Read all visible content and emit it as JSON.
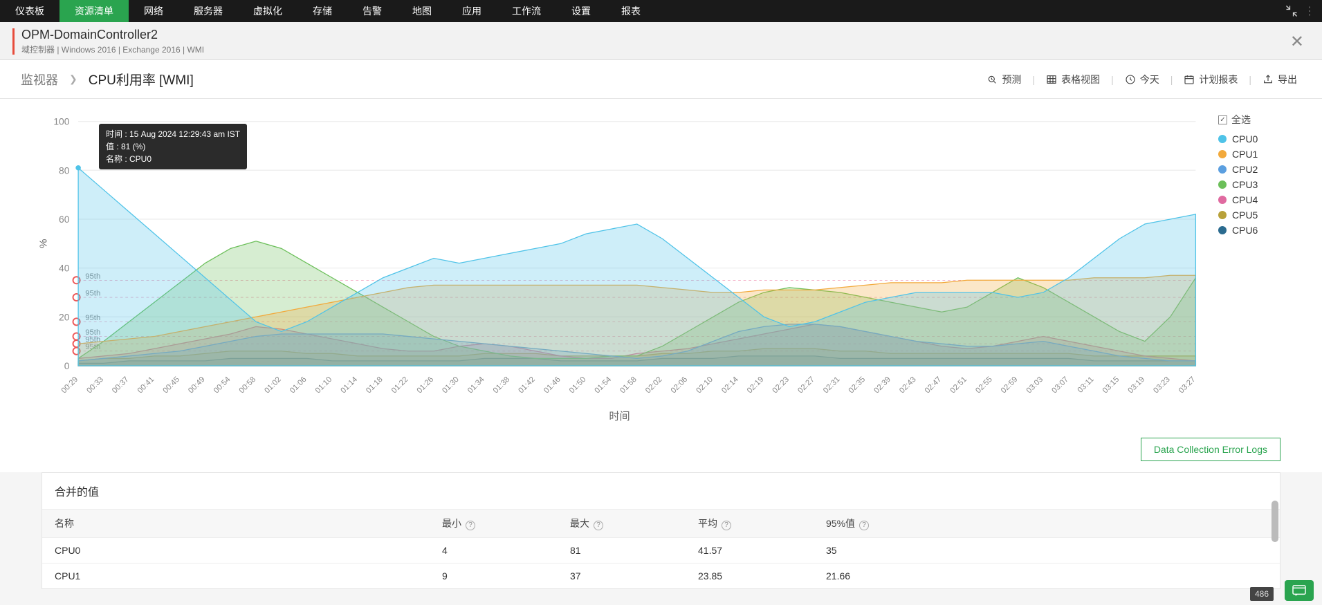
{
  "nav": {
    "items": [
      "仪表板",
      "资源清单",
      "网络",
      "服务器",
      "虚拟化",
      "存储",
      "告警",
      "地图",
      "应用",
      "工作流",
      "设置",
      "报表"
    ],
    "active_index": 1
  },
  "header": {
    "title": "OPM-DomainController2",
    "subtitle": "域控制器  |  Windows 2016   |   Exchange 2016   |  WMI"
  },
  "breadcrumb": {
    "root": "监视器",
    "current": "CPU利用率 [WMI]"
  },
  "actions": {
    "forecast": "预测",
    "table_view": "表格视图",
    "today": "今天",
    "schedule": "计划报表",
    "export": "导出"
  },
  "legend": {
    "select_all": "全选",
    "items": [
      {
        "name": "CPU0",
        "color": "#4fc3e8"
      },
      {
        "name": "CPU1",
        "color": "#f2a93b"
      },
      {
        "name": "CPU2",
        "color": "#5b9fe0"
      },
      {
        "name": "CPU3",
        "color": "#6bbf59"
      },
      {
        "name": "CPU4",
        "color": "#e06aa0"
      },
      {
        "name": "CPU5",
        "color": "#b8a13a"
      },
      {
        "name": "CPU6",
        "color": "#2b6b8f"
      }
    ]
  },
  "tooltip": {
    "time_label": "时间 : 15 Aug 2024 12:29:43 am IST",
    "value_label": "值 : 81 (%)",
    "name_label": "名称 : CPU0"
  },
  "error_button": "Data Collection Error Logs",
  "table": {
    "title": "合并的值",
    "headers": {
      "name": "名称",
      "min": "最小",
      "max": "最大",
      "avg": "平均",
      "p95": "95%值"
    },
    "rows": [
      {
        "name": "CPU0",
        "min": "4",
        "max": "81",
        "avg": "41.57",
        "p95": "35"
      },
      {
        "name": "CPU1",
        "min": "9",
        "max": "37",
        "avg": "23.85",
        "p95": "21.66"
      }
    ]
  },
  "badge": "486",
  "chart_data": {
    "type": "area",
    "ylabel": "%",
    "xlabel": "时间",
    "ylim": [
      0,
      100
    ],
    "yticks": [
      0,
      20,
      40,
      60,
      80,
      100
    ],
    "percentile_markers": [
      "95th",
      "95th",
      "95th",
      "95th",
      "95th",
      "95th"
    ],
    "categories": [
      "00:29",
      "00:33",
      "00:37",
      "00:41",
      "00:45",
      "00:49",
      "00:54",
      "00:58",
      "01:02",
      "01:06",
      "01:10",
      "01:14",
      "01:18",
      "01:22",
      "01:26",
      "01:30",
      "01:34",
      "01:38",
      "01:42",
      "01:46",
      "01:50",
      "01:54",
      "01:58",
      "02:02",
      "02:06",
      "02:10",
      "02:14",
      "02:19",
      "02:23",
      "02:27",
      "02:31",
      "02:35",
      "02:39",
      "02:43",
      "02:47",
      "02:51",
      "02:55",
      "02:59",
      "03:03",
      "03:07",
      "03:11",
      "03:15",
      "03:19",
      "03:23",
      "03:27"
    ],
    "series": [
      {
        "name": "CPU0",
        "color": "#4fc3e8",
        "values": [
          81,
          72,
          63,
          54,
          45,
          36,
          27,
          18,
          14,
          18,
          24,
          30,
          36,
          40,
          44,
          42,
          44,
          46,
          48,
          50,
          54,
          56,
          58,
          52,
          44,
          36,
          28,
          20,
          16,
          18,
          22,
          26,
          28,
          30,
          30,
          30,
          30,
          28,
          30,
          36,
          44,
          52,
          58,
          60,
          62
        ]
      },
      {
        "name": "CPU1",
        "color": "#f2a93b",
        "values": [
          9,
          10,
          11,
          12,
          14,
          16,
          18,
          20,
          22,
          24,
          26,
          28,
          30,
          32,
          33,
          33,
          33,
          33,
          33,
          33,
          33,
          33,
          33,
          32,
          31,
          30,
          30,
          31,
          31,
          31,
          32,
          33,
          34,
          34,
          34,
          35,
          35,
          35,
          35,
          35,
          36,
          36,
          36,
          37,
          37
        ]
      },
      {
        "name": "CPU2",
        "color": "#5b9fe0",
        "values": [
          2,
          3,
          4,
          5,
          6,
          8,
          10,
          12,
          13,
          13,
          13,
          13,
          13,
          12,
          11,
          10,
          9,
          8,
          7,
          6,
          5,
          4,
          3,
          4,
          6,
          10,
          14,
          16,
          17,
          17,
          16,
          14,
          12,
          10,
          9,
          8,
          8,
          9,
          10,
          8,
          6,
          4,
          3,
          2,
          2
        ]
      },
      {
        "name": "CPU3",
        "color": "#6bbf59",
        "values": [
          3,
          10,
          18,
          26,
          34,
          42,
          48,
          51,
          48,
          42,
          36,
          30,
          24,
          18,
          12,
          8,
          6,
          4,
          3,
          3,
          3,
          4,
          4,
          8,
          14,
          20,
          26,
          30,
          32,
          31,
          30,
          28,
          26,
          24,
          22,
          24,
          30,
          36,
          32,
          26,
          20,
          14,
          10,
          20,
          36
        ]
      },
      {
        "name": "CPU4",
        "color": "#e06aa0",
        "values": [
          3,
          4,
          5,
          7,
          9,
          11,
          13,
          16,
          15,
          13,
          11,
          9,
          7,
          6,
          6,
          8,
          9,
          8,
          6,
          4,
          3,
          3,
          5,
          6,
          7,
          9,
          11,
          13,
          15,
          17,
          16,
          14,
          12,
          10,
          8,
          7,
          8,
          10,
          12,
          10,
          8,
          6,
          4,
          3,
          2
        ]
      },
      {
        "name": "CPU5",
        "color": "#b8a13a",
        "values": [
          2,
          3,
          3,
          4,
          4,
          5,
          6,
          6,
          6,
          5,
          5,
          4,
          4,
          4,
          4,
          4,
          5,
          5,
          5,
          4,
          4,
          4,
          4,
          5,
          5,
          6,
          6,
          7,
          7,
          7,
          6,
          6,
          5,
          5,
          5,
          5,
          5,
          5,
          5,
          5,
          4,
          4,
          4,
          4,
          4
        ]
      },
      {
        "name": "CPU6",
        "color": "#2b6b8f",
        "values": [
          1,
          1,
          2,
          2,
          2,
          2,
          3,
          3,
          3,
          3,
          2,
          2,
          2,
          2,
          2,
          2,
          3,
          3,
          3,
          2,
          2,
          2,
          2,
          3,
          3,
          3,
          4,
          4,
          4,
          4,
          3,
          3,
          3,
          3,
          3,
          3,
          3,
          3,
          3,
          3,
          2,
          2,
          2,
          2,
          2
        ]
      }
    ]
  }
}
